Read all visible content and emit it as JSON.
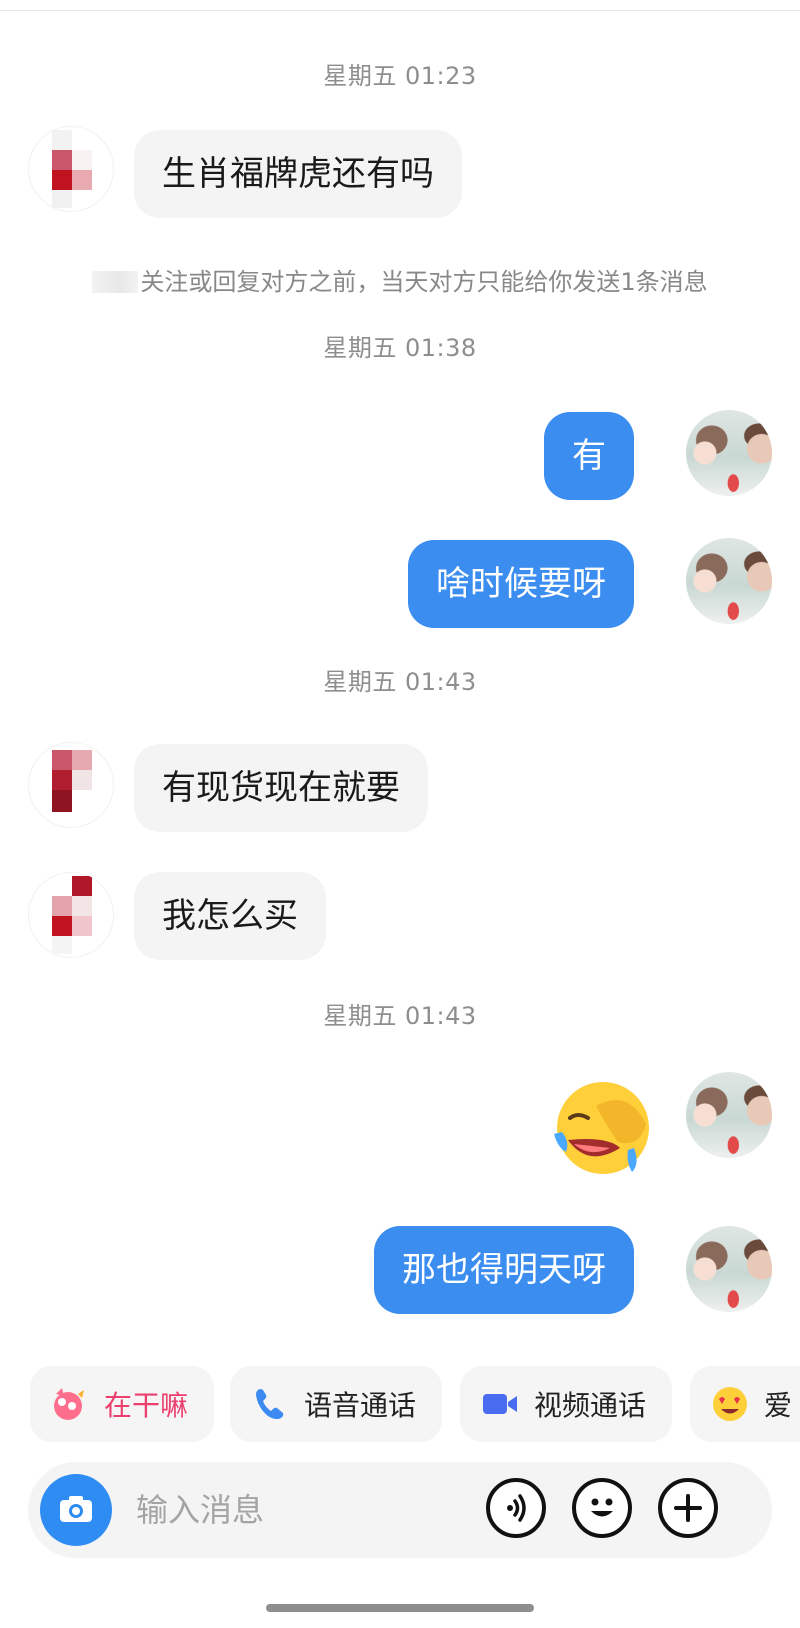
{
  "messages": {
    "time1": "星期五 01:23",
    "msg1": "生肖福牌虎还有吗",
    "notice": "关注或回复对方之前，当天对方只能给你发送1条消息",
    "time2": "星期五 01:38",
    "msg2": "有",
    "msg3": "啥时候要呀",
    "time3": "星期五 01:43",
    "msg4": "有现货现在就要",
    "msg5": "我怎么买",
    "time4": "星期五 01:43",
    "msg6_sticker": "laughing-crying-emoji",
    "msg7": "那也得明天呀"
  },
  "quick_actions": [
    {
      "label": "在干嘛",
      "icon": "cat-hug-icon"
    },
    {
      "label": "语音通话",
      "icon": "phone-icon"
    },
    {
      "label": "视频通话",
      "icon": "video-camera-icon"
    },
    {
      "label": "爱",
      "icon": "heart-eyes-emoji-icon"
    }
  ],
  "input": {
    "placeholder": "输入消息"
  },
  "colors": {
    "outgoing_bubble": "#3b8ef0",
    "incoming_bubble": "#f4f4f4",
    "accent_pink": "#ec3f6d"
  }
}
